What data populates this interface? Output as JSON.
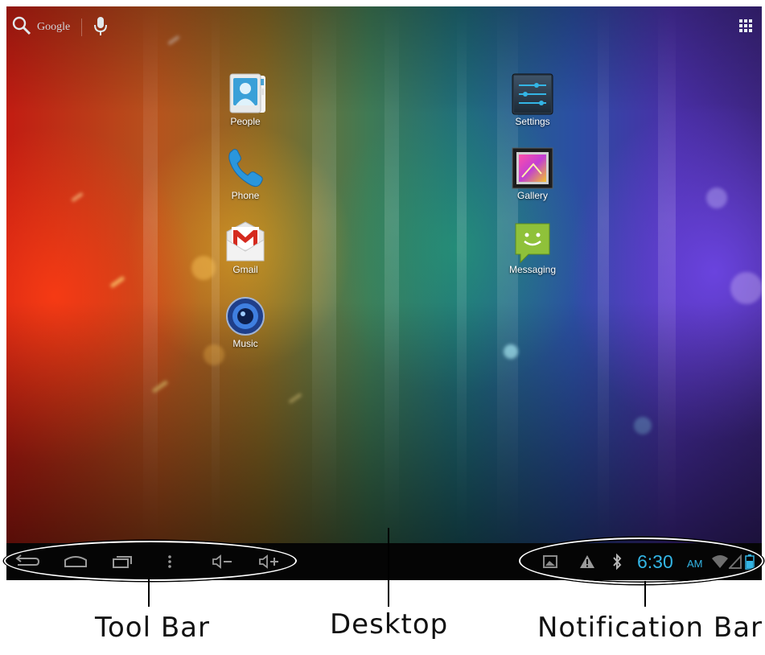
{
  "search": {
    "label": "Google"
  },
  "apps_left": [
    {
      "label": "People"
    },
    {
      "label": "Phone"
    },
    {
      "label": "Gmail"
    },
    {
      "label": "Music"
    }
  ],
  "apps_right": [
    {
      "label": "Settings"
    },
    {
      "label": "Gallery"
    },
    {
      "label": "Messaging"
    }
  ],
  "status": {
    "time": "6:30",
    "ampm": "AM"
  },
  "annotations": {
    "toolbar": "Tool Bar",
    "desktop": "Desktop",
    "notification": "Notification Bar"
  },
  "colors": {
    "clock": "#33b5e5",
    "navbar": "#050505"
  }
}
